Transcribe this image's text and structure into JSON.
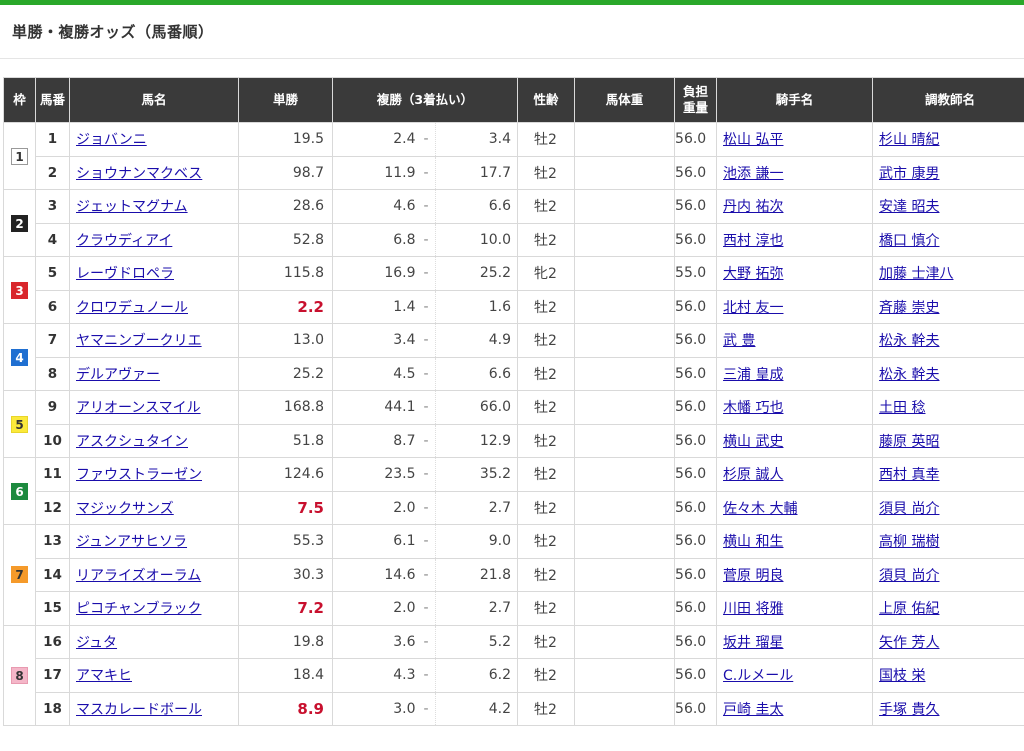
{
  "page_title": "単勝・複勝オッズ（馬番順）",
  "columns": [
    "枠",
    "馬番",
    "馬名",
    "単勝",
    "複勝（3着払い）",
    "性齢",
    "馬体重",
    "負担\n重量",
    "騎手名",
    "調教師名"
  ],
  "waku": [
    {
      "label": "1",
      "rows": 2,
      "bg": "#ffffff",
      "fg": "#333333",
      "border": "#999999"
    },
    {
      "label": "2",
      "rows": 2,
      "bg": "#222222",
      "fg": "#ffffff",
      "border": "#222222"
    },
    {
      "label": "3",
      "rows": 2,
      "bg": "#d9262c",
      "fg": "#ffffff",
      "border": "#d9262c"
    },
    {
      "label": "4",
      "rows": 2,
      "bg": "#1f6fd1",
      "fg": "#ffffff",
      "border": "#1f6fd1"
    },
    {
      "label": "5",
      "rows": 2,
      "bg": "#fbe93a",
      "fg": "#333333",
      "border": "#e8d52a"
    },
    {
      "label": "6",
      "rows": 2,
      "bg": "#1c8a3e",
      "fg": "#ffffff",
      "border": "#1c8a3e"
    },
    {
      "label": "7",
      "rows": 3,
      "bg": "#f59a2a",
      "fg": "#333333",
      "border": "#f59a2a"
    },
    {
      "label": "8",
      "rows": 3,
      "bg": "#f4b6c8",
      "fg": "#333333",
      "border": "#e89ab0"
    }
  ],
  "horses": [
    {
      "num": "1",
      "name": "ジョバンニ",
      "win": "19.5",
      "hot": false,
      "plo": "2.4",
      "phi": "3.4",
      "sex": "牡2",
      "kin": "56.0",
      "jockey": "松山 弘平",
      "trainer": "杉山 晴紀"
    },
    {
      "num": "2",
      "name": "ショウナンマクベス",
      "win": "98.7",
      "hot": false,
      "plo": "11.9",
      "phi": "17.7",
      "sex": "牡2",
      "kin": "56.0",
      "jockey": "池添 謙一",
      "trainer": "武市 康男"
    },
    {
      "num": "3",
      "name": "ジェットマグナム",
      "win": "28.6",
      "hot": false,
      "plo": "4.6",
      "phi": "6.6",
      "sex": "牡2",
      "kin": "56.0",
      "jockey": "丹内 祐次",
      "trainer": "安達 昭夫"
    },
    {
      "num": "4",
      "name": "クラウディアイ",
      "win": "52.8",
      "hot": false,
      "plo": "6.8",
      "phi": "10.0",
      "sex": "牡2",
      "kin": "56.0",
      "jockey": "西村 淳也",
      "trainer": "橋口 慎介"
    },
    {
      "num": "5",
      "name": "レーヴドロペラ",
      "win": "115.8",
      "hot": false,
      "plo": "16.9",
      "phi": "25.2",
      "sex": "牝2",
      "kin": "55.0",
      "jockey": "大野 拓弥",
      "trainer": "加藤 士津八"
    },
    {
      "num": "6",
      "name": "クロワデュノール",
      "win": "2.2",
      "hot": true,
      "plo": "1.4",
      "phi": "1.6",
      "sex": "牡2",
      "kin": "56.0",
      "jockey": "北村 友一",
      "trainer": "斉藤 崇史"
    },
    {
      "num": "7",
      "name": "ヤマニンブークリエ",
      "win": "13.0",
      "hot": false,
      "plo": "3.4",
      "phi": "4.9",
      "sex": "牡2",
      "kin": "56.0",
      "jockey": "武 豊",
      "trainer": "松永 幹夫"
    },
    {
      "num": "8",
      "name": "デルアヴァー",
      "win": "25.2",
      "hot": false,
      "plo": "4.5",
      "phi": "6.6",
      "sex": "牡2",
      "kin": "56.0",
      "jockey": "三浦 皇成",
      "trainer": "松永 幹夫"
    },
    {
      "num": "9",
      "name": "アリオーンスマイル",
      "win": "168.8",
      "hot": false,
      "plo": "44.1",
      "phi": "66.0",
      "sex": "牡2",
      "kin": "56.0",
      "jockey": "木幡 巧也",
      "trainer": "土田 稔"
    },
    {
      "num": "10",
      "name": "アスクシュタイン",
      "win": "51.8",
      "hot": false,
      "plo": "8.7",
      "phi": "12.9",
      "sex": "牡2",
      "kin": "56.0",
      "jockey": "横山 武史",
      "trainer": "藤原 英昭"
    },
    {
      "num": "11",
      "name": "ファウストラーゼン",
      "win": "124.6",
      "hot": false,
      "plo": "23.5",
      "phi": "35.2",
      "sex": "牡2",
      "kin": "56.0",
      "jockey": "杉原 誠人",
      "trainer": "西村 真幸"
    },
    {
      "num": "12",
      "name": "マジックサンズ",
      "win": "7.5",
      "hot": true,
      "plo": "2.0",
      "phi": "2.7",
      "sex": "牡2",
      "kin": "56.0",
      "jockey": "佐々木 大輔",
      "trainer": "須貝 尚介"
    },
    {
      "num": "13",
      "name": "ジュンアサヒソラ",
      "win": "55.3",
      "hot": false,
      "plo": "6.1",
      "phi": "9.0",
      "sex": "牡2",
      "kin": "56.0",
      "jockey": "横山 和生",
      "trainer": "高柳 瑞樹"
    },
    {
      "num": "14",
      "name": "リアライズオーラム",
      "win": "30.3",
      "hot": false,
      "plo": "14.6",
      "phi": "21.8",
      "sex": "牡2",
      "kin": "56.0",
      "jockey": "菅原 明良",
      "trainer": "須貝 尚介"
    },
    {
      "num": "15",
      "name": "ピコチャンブラック",
      "win": "7.2",
      "hot": true,
      "plo": "2.0",
      "phi": "2.7",
      "sex": "牡2",
      "kin": "56.0",
      "jockey": "川田 将雅",
      "trainer": "上原 佑紀"
    },
    {
      "num": "16",
      "name": "ジュタ",
      "win": "19.8",
      "hot": false,
      "plo": "3.6",
      "phi": "5.2",
      "sex": "牡2",
      "kin": "56.0",
      "jockey": "坂井 瑠星",
      "trainer": "矢作 芳人"
    },
    {
      "num": "17",
      "name": "アマキヒ",
      "win": "18.4",
      "hot": false,
      "plo": "4.3",
      "phi": "6.2",
      "sex": "牡2",
      "kin": "56.0",
      "jockey": "C.ルメール",
      "trainer": "国枝 栄"
    },
    {
      "num": "18",
      "name": "マスカレードボール",
      "win": "8.9",
      "hot": true,
      "plo": "3.0",
      "phi": "4.2",
      "sex": "牡2",
      "kin": "56.0",
      "jockey": "戸崎 圭太",
      "trainer": "手塚 貴久"
    }
  ],
  "dash": "-"
}
